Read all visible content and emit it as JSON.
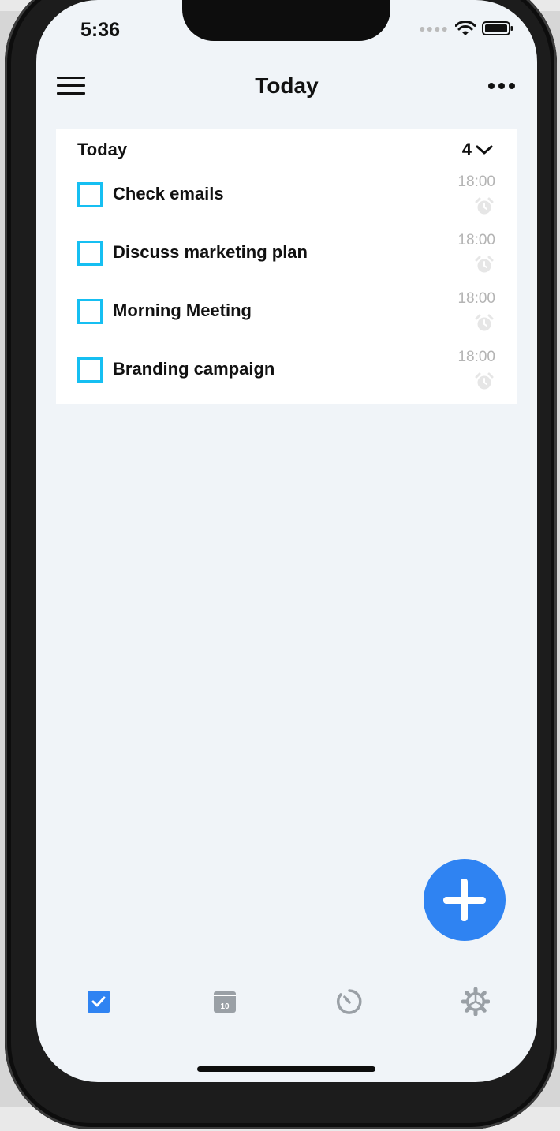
{
  "status_bar": {
    "time": "5:36"
  },
  "nav": {
    "title": "Today"
  },
  "section": {
    "title": "Today",
    "count": "4"
  },
  "tasks": [
    {
      "title": "Check emails",
      "time": "18:00"
    },
    {
      "title": "Discuss marketing plan",
      "time": "18:00"
    },
    {
      "title": "Morning Meeting",
      "time": "18:00"
    },
    {
      "title": "Branding campaign",
      "time": "18:00"
    }
  ],
  "tabs": [
    {
      "icon": "checkbox-icon",
      "active": true
    },
    {
      "icon": "calendar-icon",
      "label": "10"
    },
    {
      "icon": "timer-icon"
    },
    {
      "icon": "settings-gear-icon"
    }
  ],
  "colors": {
    "accent": "#2f83f2",
    "checkbox": "#16bff2",
    "background": "#f0f4f8",
    "muted": "#b4b4b4"
  }
}
